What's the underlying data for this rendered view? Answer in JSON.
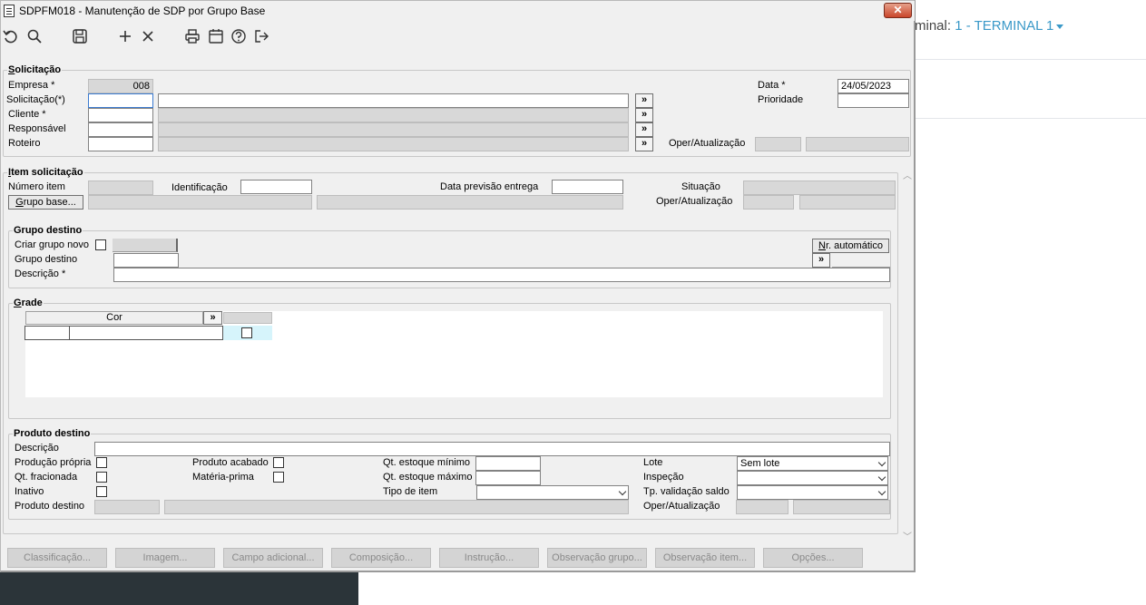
{
  "window": {
    "title": "SDPFM018 - Manutenção de SDP por Grupo Base",
    "close_label": "✕"
  },
  "toolbar": {
    "icons": [
      "undo-icon",
      "search-icon",
      "save-icon",
      "add-icon",
      "delete-icon",
      "print-icon",
      "calendar-icon",
      "help-icon",
      "exit-icon"
    ]
  },
  "background": {
    "terminal_label": "rminal:",
    "terminal_value": "1 - TERMINAL 1"
  },
  "solicitacao": {
    "group_label": "Solicitação",
    "empresa_label": "Empresa *",
    "empresa_value": "008",
    "solicitacao_label": "Solicitação(*)",
    "cliente_label": "Cliente *",
    "responsavel_label": "Responsável",
    "roteiro_label": "Roteiro",
    "data_label": "Data *",
    "data_value": "24/05/2023",
    "prioridade_label": "Prioridade",
    "oper_label": "Oper/Atualização",
    "arrow": "»"
  },
  "item": {
    "group_label": "Item solicitação",
    "numero_label": "Número item",
    "identificacao_label": "Identificação",
    "data_prev_label": "Data previsão entrega",
    "situacao_label": "Situação",
    "grupo_base_button": "Grupo base...",
    "oper_label": "Oper/Atualização"
  },
  "grupo_destino": {
    "group_label": "Grupo destino",
    "criar_label": "Criar grupo novo",
    "grupo_label": "Grupo destino",
    "descricao_label": "Descrição *",
    "nr_auto_button": "Nr. automático",
    "arrow": "»"
  },
  "grade": {
    "group_label": "Grade",
    "cor_header": "Cor",
    "arrow": "»"
  },
  "produto": {
    "group_label": "Produto destino",
    "descricao_label": "Descrição",
    "producao_label": "Produção própria",
    "fracionada_label": "Qt. fracionada",
    "inativo_label": "Inativo",
    "produto_destino_label": "Produto destino",
    "acabado_label": "Produto acabado",
    "materia_label": "Matéria-prima",
    "est_min_label": "Qt. estoque mínimo",
    "est_max_label": "Qt. estoque máximo",
    "tipo_item_label": "Tipo de item",
    "lote_label": "Lote",
    "lote_value": "Sem lote",
    "inspecao_label": "Inspeção",
    "tp_validacao_label": "Tp. validação saldo",
    "oper_label": "Oper/Atualização"
  },
  "bottom_buttons": [
    "Classificação...",
    "Imagem...",
    "Campo adicional...",
    "Composição...",
    "Instrução...",
    "Observação grupo...",
    "Observação item...",
    "Opções..."
  ]
}
